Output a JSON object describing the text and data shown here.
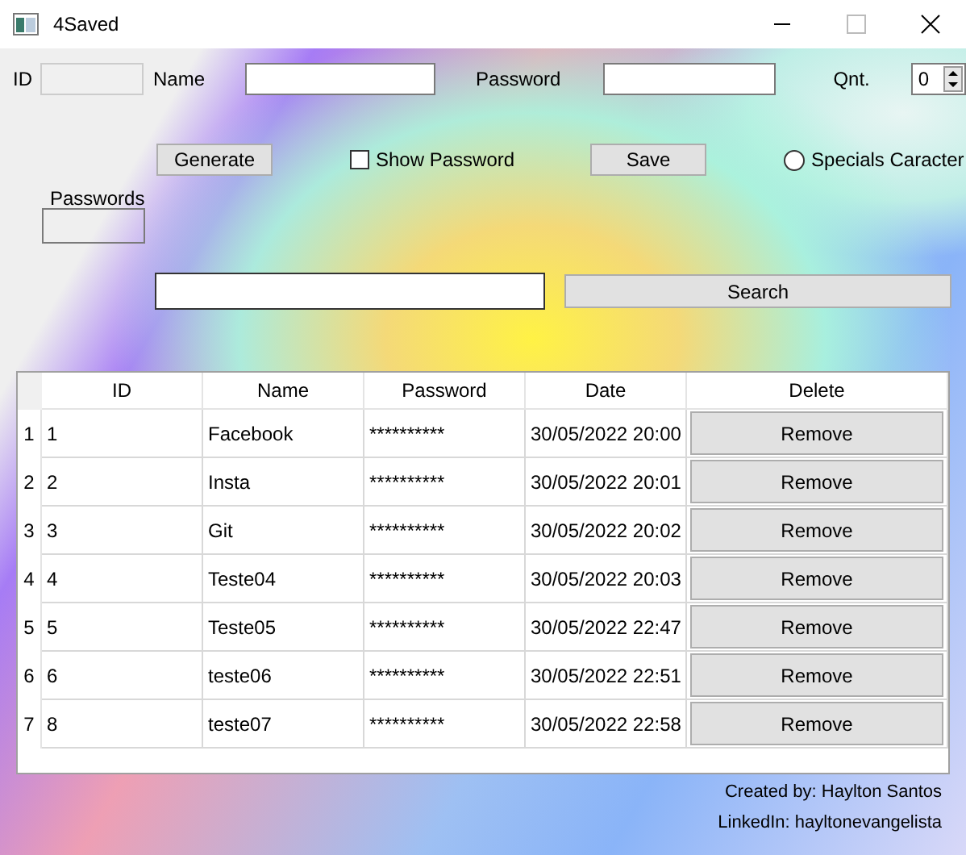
{
  "window": {
    "title": "4Saved"
  },
  "form": {
    "id_label": "ID",
    "id_field": {
      "disabled": true
    },
    "name_label": "Name",
    "password_label": "Password",
    "qnt_label": "Qnt.",
    "qnt_value": "0",
    "generate_button": "Generate",
    "show_password": {
      "label": "Show Password",
      "checked": false
    },
    "save_button": "Save",
    "specials": {
      "label": "Specials Caracter",
      "selected": false
    },
    "passwords_label": "Passwords"
  },
  "search": {
    "button": "Search"
  },
  "table": {
    "columns": [
      "ID",
      "Name",
      "Password",
      "Date",
      "Delete"
    ],
    "rows": [
      {
        "number": "1",
        "id": "1",
        "name": "Facebook",
        "password": "**********",
        "date": "30/05/2022 20:00",
        "action": "Remove"
      },
      {
        "number": "2",
        "id": "2",
        "name": "Insta",
        "password": "**********",
        "date": "30/05/2022 20:01",
        "action": "Remove"
      },
      {
        "number": "3",
        "id": "3",
        "name": "Git",
        "password": "**********",
        "date": "30/05/2022 20:02",
        "action": "Remove"
      },
      {
        "number": "4",
        "id": "4",
        "name": "Teste04",
        "password": "**********",
        "date": "30/05/2022 20:03",
        "action": "Remove"
      },
      {
        "number": "5",
        "id": "5",
        "name": "Teste05",
        "password": "**********",
        "date": "30/05/2022 22:47",
        "action": "Remove"
      },
      {
        "number": "6",
        "id": "6",
        "name": "teste06",
        "password": "**********",
        "date": "30/05/2022 22:51",
        "action": "Remove"
      },
      {
        "number": "7",
        "id": "8",
        "name": "teste07",
        "password": "**********",
        "date": "30/05/2022 22:58",
        "action": "Remove"
      }
    ]
  },
  "footer": [
    "Created by: Haylton Santos",
    "LinkedIn: hayltonevangelista"
  ]
}
